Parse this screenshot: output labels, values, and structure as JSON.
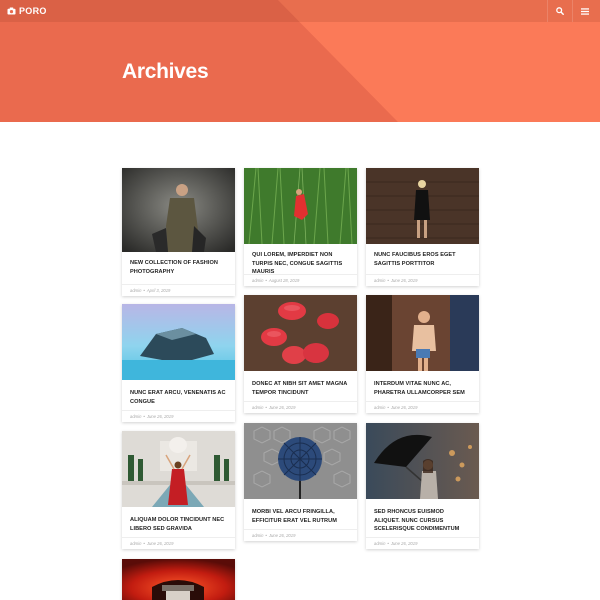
{
  "site": {
    "name": "PORO"
  },
  "header": {
    "title": "Archives",
    "accent": "#f07456",
    "search_icon": "search-icon",
    "menu_icon": "menu-icon"
  },
  "posts": [
    {
      "title": "NEW COLLECTION OF FASHION PHOTOGRAPHY",
      "author": "admin",
      "date": "April 3, 2019"
    },
    {
      "title": "QUI LOREM, IMPERDIET NON TURPIS NEC, CONGUE SAGITTIS MAURIS",
      "author": "admin",
      "date": "August 28, 2019"
    },
    {
      "title": "NUNC FAUCIBUS EROS EGET SAGITTIS PORTTITOR",
      "author": "admin",
      "date": "June 26, 2019"
    },
    {
      "title": "NUNC ERAT ARCU, VENENATIS AC CONGUE",
      "author": "admin",
      "date": "June 26, 2019"
    },
    {
      "title": "DONEC AT NIBH SIT AMET MAGNA TEMPOR TINCIDUNT",
      "author": "admin",
      "date": "June 26, 2019"
    },
    {
      "title": "INTERDUM VITAE NUNC AC, PHARETRA ULLAMCORPER SEM",
      "author": "admin",
      "date": "June 26, 2019"
    },
    {
      "title": "ALIQUAM DOLOR TINCIDUNT NEC LIBERO SED GRAVIDA",
      "author": "admin",
      "date": "June 26, 2019"
    },
    {
      "title": "MORBI VEL ARCU FRINGILLA, EFFICITUR ERAT VEL RUTRUM",
      "author": "admin",
      "date": "June 26, 2019"
    },
    {
      "title": "SED RHONCUS EUISMOD ALIQUET. NUNC CURSUS SCELERISQUE CONDIMENTUM",
      "author": "admin",
      "date": "June 26, 2019"
    }
  ]
}
